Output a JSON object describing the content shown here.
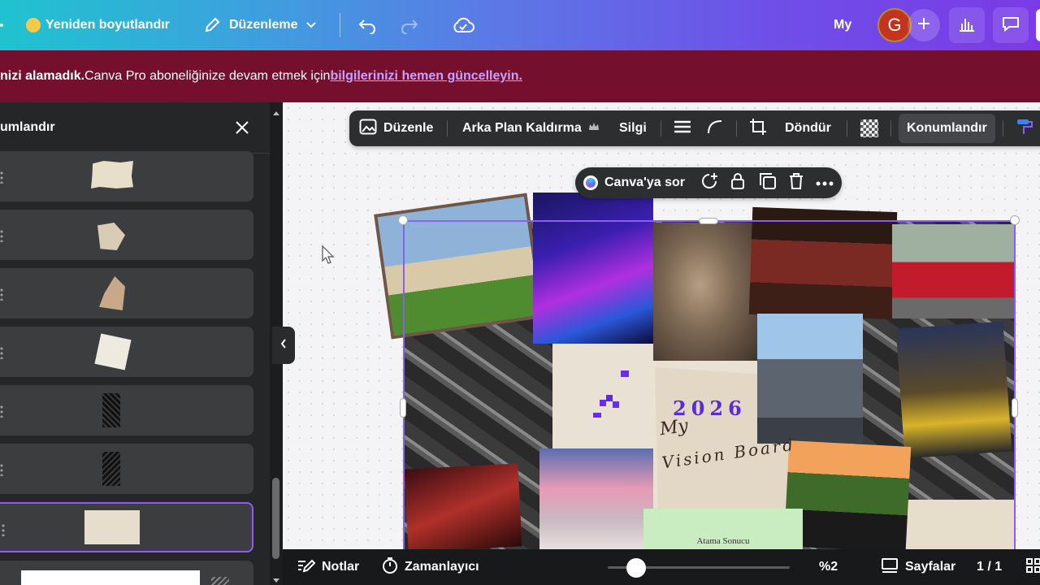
{
  "topbar": {
    "resize_label": "Yeniden boyutlandır",
    "edit_label": "Düzenleme",
    "my_label": "My",
    "avatar_letter": "G"
  },
  "banner": {
    "bold_text": "nizi alamadık.",
    "text": " Canva Pro aboneliğinize devam etmek için ",
    "link_text": "bilgilerinizi hemen güncelleyin."
  },
  "panel": {
    "title": "umlandır",
    "layers": [
      {
        "kind": "paper"
      },
      {
        "kind": "torn-paper"
      },
      {
        "kind": "burnt-paper"
      },
      {
        "kind": "crumpled-paper"
      },
      {
        "kind": "dark-texture"
      },
      {
        "kind": "dark-texture"
      },
      {
        "kind": "paper",
        "selected": true
      },
      {
        "kind": "white-shape"
      }
    ]
  },
  "toolbar": {
    "edit": "Düzenle",
    "bg_remove": "Arka Plan Kaldırma",
    "erase": "Silgi",
    "rotate": "Döndür",
    "position": "Konumlandır"
  },
  "context_menu": {
    "ask": "Canva'ya sor"
  },
  "collage": {
    "year_text": "2026",
    "script_my": "My",
    "script_vision": "Vision Board",
    "caption": "Atama Sonucu"
  },
  "bottombar": {
    "notes": "Notlar",
    "timer": "Zamanlayıcı",
    "zoom": "%2",
    "zoom_level": 0.04,
    "pages": "Sayfalar",
    "page_count": "1 / 1"
  },
  "colors": {
    "accent": "#8b5cf6",
    "banner_bg": "#74102e",
    "link": "#c7a1ff"
  }
}
